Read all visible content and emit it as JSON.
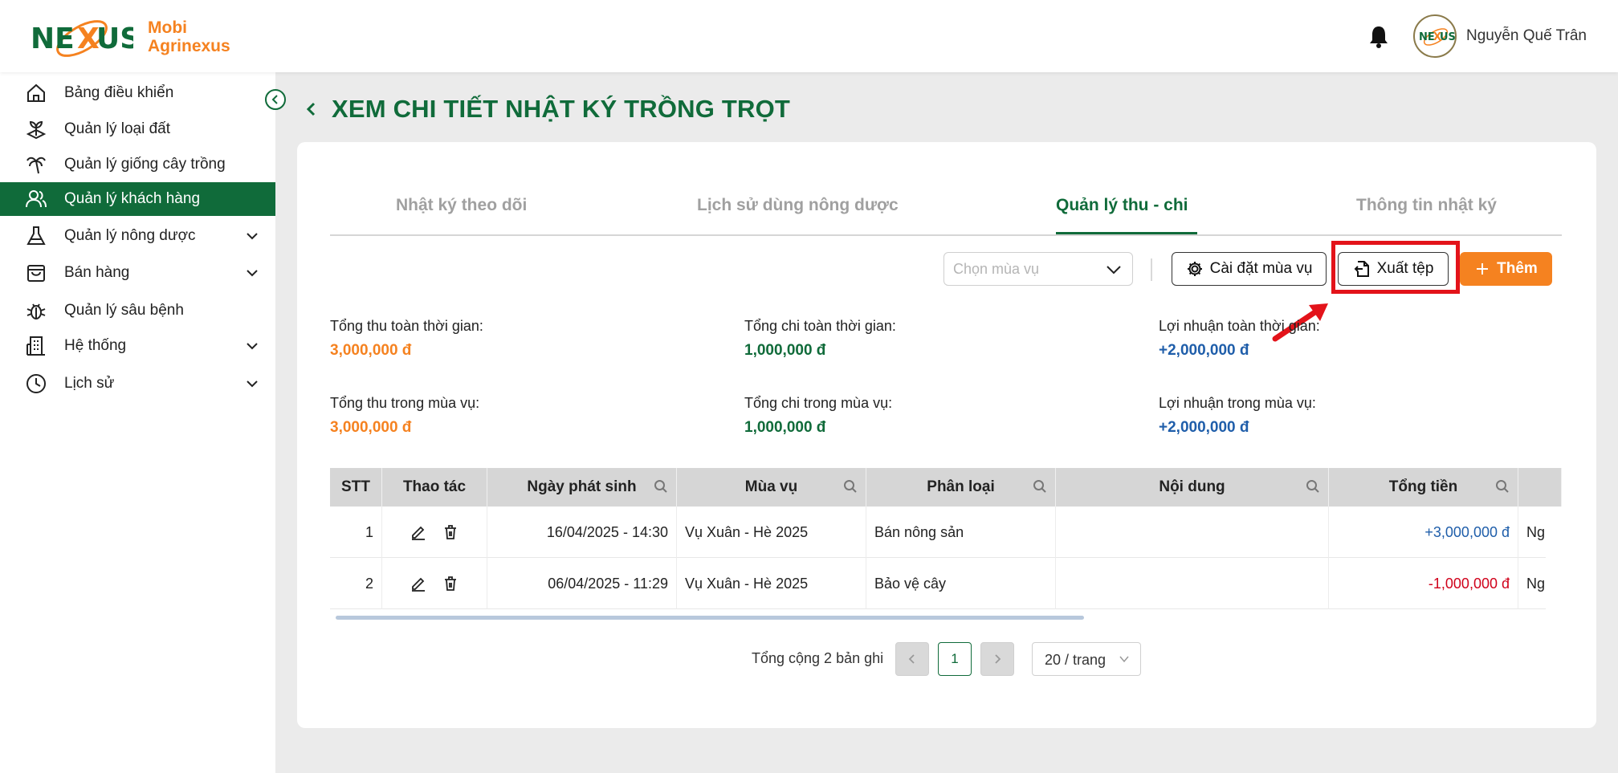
{
  "header": {
    "brand": "Mobi Agrinexus",
    "brand_line1": "Mobi",
    "brand_line2": "Agrinexus",
    "logo_text": "NEXUS",
    "username": "Nguyễn Quế Trân"
  },
  "sidebar": {
    "items": [
      {
        "label": "Bảng điều khiển",
        "icon": "home-icon"
      },
      {
        "label": "Quản lý loại đất",
        "icon": "soil-icon"
      },
      {
        "label": "Quản lý giống cây trồng",
        "icon": "palm-tree-icon"
      },
      {
        "label": "Quản lý khách hàng",
        "icon": "users-icon",
        "active": true
      },
      {
        "label": "Quản lý nông dược",
        "icon": "flask-icon",
        "expandable": true
      },
      {
        "label": "Bán hàng",
        "icon": "shopping-bag-icon",
        "expandable": true
      },
      {
        "label": "Quản lý sâu bệnh",
        "icon": "bug-icon"
      },
      {
        "label": "Hệ thống",
        "icon": "building-icon",
        "expandable": true
      },
      {
        "label": "Lịch sử",
        "icon": "clock-icon",
        "expandable": true
      }
    ]
  },
  "page": {
    "title": "XEM CHI TIẾT NHẬT KÝ TRỒNG TRỌT"
  },
  "tabs": [
    {
      "label": "Nhật ký theo dõi",
      "active": false
    },
    {
      "label": "Lịch sử dùng nông dược",
      "active": false
    },
    {
      "label": "Quản lý thu - chi",
      "active": true
    },
    {
      "label": "Thông tin nhật ký",
      "active": false
    }
  ],
  "toolbar": {
    "season_placeholder": "Chọn mùa vụ",
    "settings_label": "Cài đặt mùa vụ",
    "export_label": "Xuất tệp",
    "add_label": "Thêm"
  },
  "summary": {
    "total_income_all_label": "Tổng thu toàn thời gian:",
    "total_income_all": "3,000,000 đ",
    "total_expense_all_label": "Tổng chi toàn thời gian:",
    "total_expense_all": "1,000,000 đ",
    "profit_all_label": "Lợi nhuận toàn thời gian:",
    "profit_all": "+2,000,000 đ",
    "total_income_season_label": "Tổng thu trong mùa vụ:",
    "total_income_season": "3,000,000 đ",
    "total_expense_season_label": "Tổng chi trong mùa vụ:",
    "total_expense_season": "1,000,000 đ",
    "profit_season_label": "Lợi nhuận trong mùa vụ:",
    "profit_season": "+2,000,000 đ"
  },
  "table": {
    "columns": [
      "STT",
      "Thao tác",
      "Ngày phát sinh",
      "Mùa vụ",
      "Phân loại",
      "Nội dung",
      "Tổng tiền"
    ],
    "rows": [
      {
        "stt": "1",
        "date": "16/04/2025 - 14:30",
        "season": "Vụ Xuân - Hè 2025",
        "category": "Bán nông sản",
        "content": "",
        "total": "+3,000,000 đ",
        "extra": "Ng"
      },
      {
        "stt": "2",
        "date": "06/04/2025 - 11:29",
        "season": "Vụ Xuân - Hè 2025",
        "category": "Bảo vệ cây",
        "content": "",
        "total": "-1,000,000 đ",
        "extra": "Ng"
      }
    ]
  },
  "pagination": {
    "total_text": "Tổng cộng 2 bản ghi",
    "current_page": "1",
    "page_size": "20 / trang"
  },
  "colors": {
    "primary_green": "#106b3a",
    "accent_orange": "#f58220",
    "profit_blue": "#1f5eaa",
    "negative_red": "#d0021b",
    "highlight_red": "#e3131a"
  }
}
